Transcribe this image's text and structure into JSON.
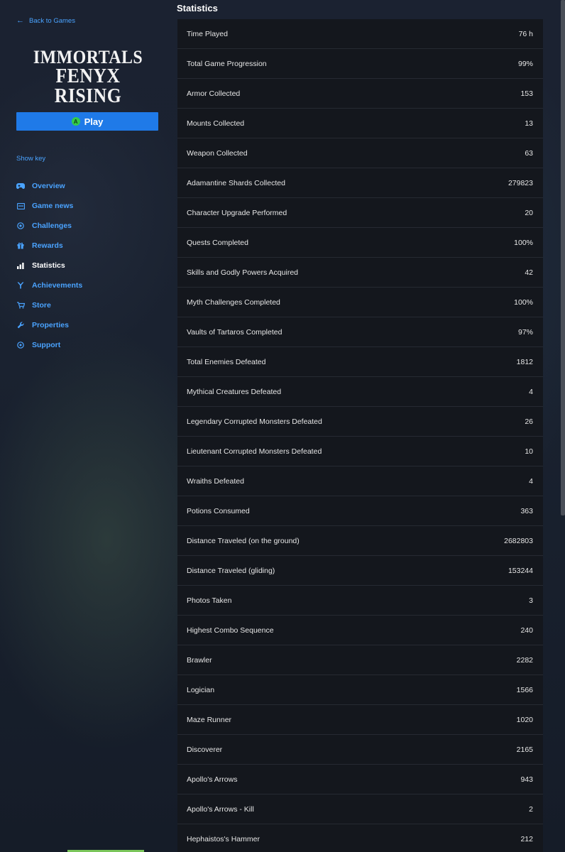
{
  "sidebar": {
    "back_label": "Back to Games",
    "logo_line1": "IMMORTALS",
    "logo_line2": "FENYX RISING",
    "play_label": "Play",
    "play_badge": "A",
    "show_key": "Show key",
    "nav": [
      {
        "label": "Overview",
        "icon": "gamepad-icon",
        "glyph": "🎮"
      },
      {
        "label": "Game news",
        "icon": "newspaper-icon",
        "glyph": "▤"
      },
      {
        "label": "Challenges",
        "icon": "target-icon",
        "glyph": "◎"
      },
      {
        "label": "Rewards",
        "icon": "gift-icon",
        "glyph": "🎁"
      },
      {
        "label": "Statistics",
        "icon": "bar-chart-icon",
        "glyph": "▮"
      },
      {
        "label": "Achievements",
        "icon": "trophy-icon",
        "glyph": "Y"
      },
      {
        "label": "Store",
        "icon": "cart-icon",
        "glyph": "🛒"
      },
      {
        "label": "Properties",
        "icon": "wrench-icon",
        "glyph": "🔧"
      },
      {
        "label": "Support",
        "icon": "help-icon",
        "glyph": "?"
      }
    ],
    "active_nav": "Statistics"
  },
  "main": {
    "title": "Statistics",
    "stats": [
      {
        "label": "Time Played",
        "value": "76 h"
      },
      {
        "label": "Total Game Progression",
        "value": "99%"
      },
      {
        "label": "Armor Collected",
        "value": "153"
      },
      {
        "label": "Mounts Collected",
        "value": "13"
      },
      {
        "label": "Weapon Collected",
        "value": "63"
      },
      {
        "label": "Adamantine Shards Collected",
        "value": "279823"
      },
      {
        "label": "Character Upgrade Performed",
        "value": "20"
      },
      {
        "label": "Quests Completed",
        "value": "100%"
      },
      {
        "label": "Skills and Godly Powers Acquired",
        "value": "42"
      },
      {
        "label": "Myth Challenges Completed",
        "value": "100%"
      },
      {
        "label": "Vaults of Tartaros Completed",
        "value": "97%"
      },
      {
        "label": "Total Enemies Defeated",
        "value": "1812"
      },
      {
        "label": "Mythical Creatures Defeated",
        "value": "4"
      },
      {
        "label": "Legendary Corrupted Monsters Defeated",
        "value": "26"
      },
      {
        "label": "Lieutenant Corrupted Monsters Defeated",
        "value": "10"
      },
      {
        "label": "Wraiths Defeated",
        "value": "4"
      },
      {
        "label": "Potions Consumed",
        "value": "363"
      },
      {
        "label": "Distance Traveled (on the ground)",
        "value": "2682803"
      },
      {
        "label": "Distance Traveled (gliding)",
        "value": "153244"
      },
      {
        "label": "Photos Taken",
        "value": "3"
      },
      {
        "label": "Highest Combo Sequence",
        "value": "240"
      },
      {
        "label": "Brawler",
        "value": "2282"
      },
      {
        "label": "Logician",
        "value": "1566"
      },
      {
        "label": "Maze Runner",
        "value": "1020"
      },
      {
        "label": "Discoverer",
        "value": "2165"
      },
      {
        "label": "Apollo's Arrows",
        "value": "943"
      },
      {
        "label": "Apollo's Arrows - Kill",
        "value": "2"
      },
      {
        "label": "Hephaistos's Hammer",
        "value": "212"
      }
    ]
  },
  "colors": {
    "accent": "#1f7ae8",
    "link": "#4aa3ff",
    "panel": "#14171d",
    "badge_green": "#33cc4a"
  }
}
